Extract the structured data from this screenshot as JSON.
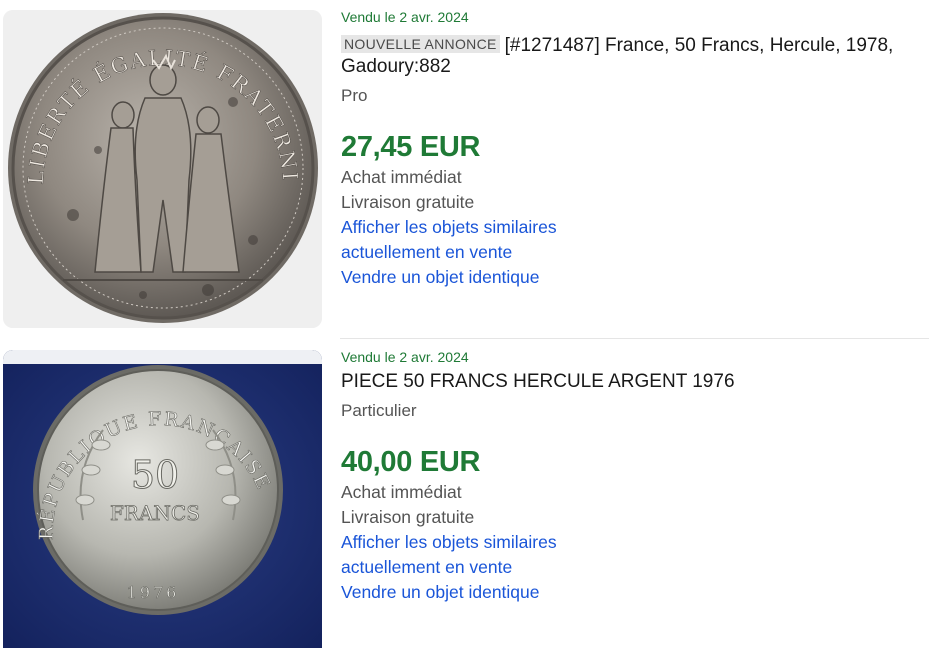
{
  "listings": [
    {
      "sold_date": "Vendu le 2 avr. 2024",
      "badge": "NOUVELLE ANNONCE",
      "title": "[#1271487] France, 50 Francs, Hercule, 1978,",
      "title_line2": "Gadoury:882",
      "seller_type": "Pro",
      "price": "27,45 EUR",
      "buy_format": "Achat immédiat",
      "shipping": "Livraison gratuite",
      "link_similar_1": "Afficher les objets similaires",
      "link_similar_2": "actuellement en vente",
      "link_sell": "Vendre un objet identique",
      "coin_legend": "LIBERTÉ ÉGALITÉ FRATERNITÉ"
    },
    {
      "sold_date": "Vendu le 2 avr. 2024",
      "title": "PIECE 50 FRANCS HERCULE ARGENT 1976",
      "seller_type": "Particulier",
      "price": "40,00 EUR",
      "buy_format": "Achat immédiat",
      "shipping": "Livraison gratuite",
      "link_similar_1": "Afficher les objets similaires",
      "link_similar_2": "actuellement en vente",
      "link_sell": "Vendre un objet identique",
      "coin_value": "50",
      "coin_unit": "FRANCS",
      "coin_legend": "RÉPUBLIQUE FRANÇAISE",
      "coin_year": "1976"
    }
  ],
  "colors": {
    "sold_green": "#1f7a36",
    "link_blue": "#1a55d8",
    "muted": "#545454"
  }
}
